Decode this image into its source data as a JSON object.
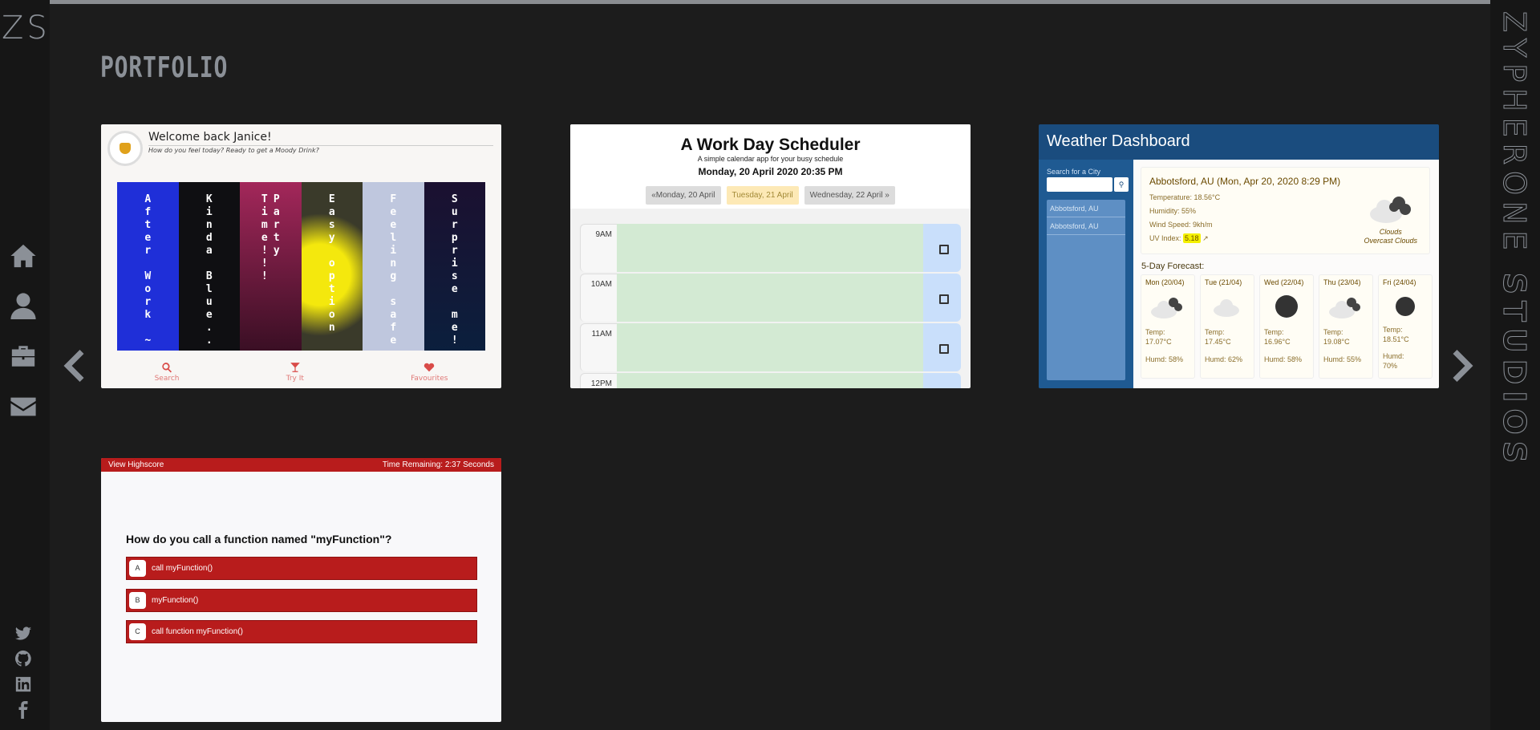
{
  "app": {
    "logo": "ZS",
    "brand_light": "ZYPHERONE ",
    "brand_bold": "STUDIOS",
    "page_title": "PORTFOLIO"
  },
  "colors": {
    "background": "#1c1c1c",
    "rail": "#161616",
    "accent": "#8b9097",
    "quiz_red": "#b81c1c",
    "weather_blue": "#1a4c7e"
  },
  "nav": {
    "items": [
      {
        "icon": "home-icon"
      },
      {
        "icon": "user-icon"
      },
      {
        "icon": "briefcase-icon"
      },
      {
        "icon": "envelope-icon"
      }
    ],
    "social": [
      {
        "icon": "twitter-icon"
      },
      {
        "icon": "github-icon"
      },
      {
        "icon": "linkedin-icon"
      },
      {
        "icon": "facebook-icon"
      }
    ]
  },
  "carousel": {
    "prev_icon": "chevron-left-icon",
    "next_icon": "chevron-right-icon"
  },
  "moody": {
    "welcome": "Welcome back Janice!",
    "subtitle": "How do you feel today? Ready to get a Moody Drink?",
    "panels": [
      {
        "label": "After Work ~",
        "color": "#1f2fd8"
      },
      {
        "label": "Kinda Blue..",
        "color": "#0f0f12"
      },
      {
        "label": "Party Time!!!",
        "color": "#7a1f48"
      },
      {
        "label": "Easy option",
        "color": "#bfa30a"
      },
      {
        "label": "Feeling safe",
        "color": "#bfc7de"
      },
      {
        "label": "Surprise me!",
        "color": "#0b1f3d"
      }
    ],
    "footer": [
      {
        "label": "Search",
        "icon": "search-icon"
      },
      {
        "label": "Try It",
        "icon": "cocktail-icon"
      },
      {
        "label": "Favourites",
        "icon": "heart-icon"
      }
    ]
  },
  "scheduler": {
    "title": "A Work Day Scheduler",
    "subtitle": "A simple calendar app for your busy schedule",
    "datetime": "Monday, 20 April 2020 20:35 PM",
    "days": [
      "«Monday, 20 April",
      "Tuesday, 21 April",
      "Wednesday, 22 April »"
    ],
    "hours": [
      "9AM",
      "10AM",
      "11AM",
      "12PM"
    ]
  },
  "weather": {
    "title": "Weather Dashboard",
    "search_label": "Search for a City",
    "history": [
      "Abbotsford, AU",
      "Abbotsford, AU"
    ],
    "current": {
      "city": "Abbotsford, AU (Mon, Apr 20, 2020 8:29 PM)",
      "temp": "Temperature: 18.56°C",
      "humidity": "Humidity: 55%",
      "wind": "Wind Speed: 9kh/m",
      "uv_label": "UV Index:",
      "uv_value": "5.18",
      "cond1": "Clouds",
      "cond2": "Overcast Clouds"
    },
    "forecast_title": "5-Day Forecast:",
    "forecast": [
      {
        "day": "Mon (20/04)",
        "temp": "Temp:",
        "temp_v": "17.07°C",
        "humd": "Humd: 58%",
        "icon": "clouds"
      },
      {
        "day": "Tue (21/04)",
        "temp": "Temp:",
        "temp_v": "17.45°C",
        "humd": "Humd: 62%",
        "icon": "cloud"
      },
      {
        "day": "Wed (22/04)",
        "temp": "Temp:",
        "temp_v": "16.96°C",
        "humd": "Humd: 58%",
        "icon": "dark"
      },
      {
        "day": "Thu (23/04)",
        "temp": "Temp:",
        "temp_v": "19.08°C",
        "humd": "Humd: 55%",
        "icon": "clouds"
      },
      {
        "day": "Fri (24/04)",
        "temp": "Temp:",
        "temp_v": "18.51°C",
        "humd": "Humd:",
        "humd_v": "70%",
        "icon": "dark"
      }
    ]
  },
  "quiz": {
    "highscore": "View Highscore",
    "timer": "Time Remaining: 2:37 Seconds",
    "question": "How do you call a function named \"myFunction\"?",
    "options": [
      {
        "letter": "A",
        "text": "call myFunction()"
      },
      {
        "letter": "B",
        "text": "myFunction()"
      },
      {
        "letter": "C",
        "text": "call function myFunction()"
      }
    ]
  }
}
